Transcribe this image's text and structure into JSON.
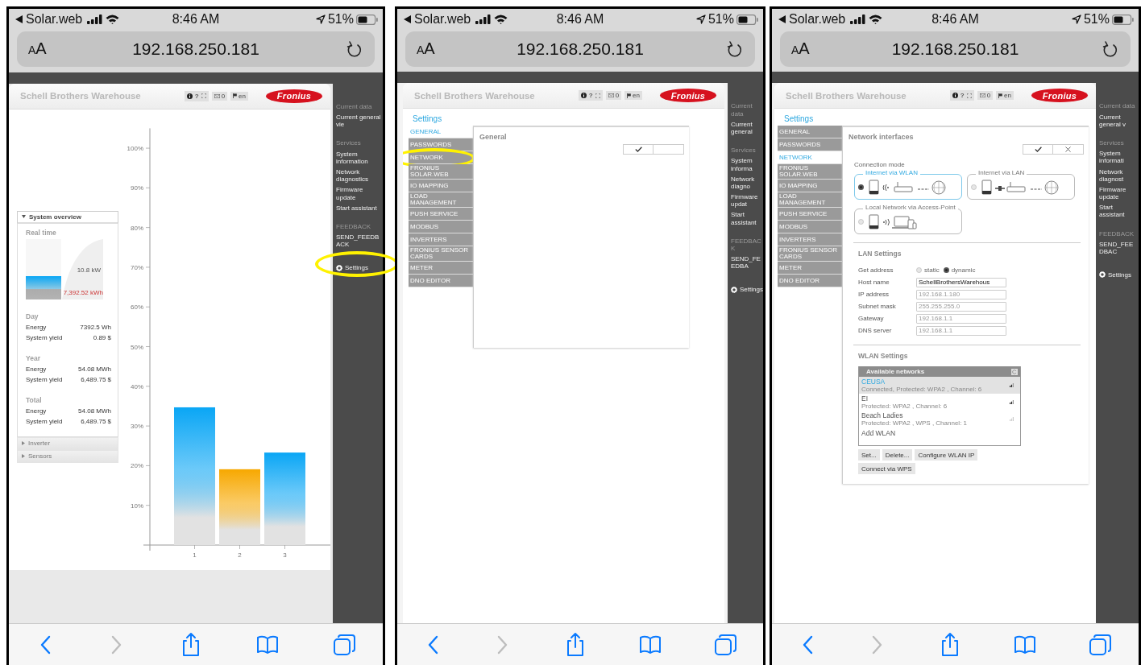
{
  "phones": [
    {
      "status_bar": {
        "back_label": "Solar.web",
        "time": "8:46 AM",
        "battery": "51%"
      },
      "address_bar": {
        "text_size": "AA",
        "url": "192.168.250.181"
      },
      "site": {
        "title": "Schell Brothers Warehouse",
        "help": "?",
        "mail_count": "0",
        "language": "en",
        "logo": "Fronius"
      },
      "sidebar": {
        "sections": [
          {
            "heading": "Current data",
            "items": [
              "Current general vie"
            ]
          },
          {
            "heading": "Services",
            "items": [
              "System information",
              "Network diagnostics",
              "Firmware update",
              "Start assistant"
            ]
          },
          {
            "heading": "FEEDBACK",
            "items": [
              "SEND_FEEDBACK"
            ]
          }
        ],
        "settings": {
          "label": "Settings",
          "highlighted": true
        }
      },
      "view": {
        "kind": "dashboard",
        "panels": [
          {
            "title": "System overview",
            "expanded": true
          },
          {
            "title": "Inverter",
            "expanded": false
          },
          {
            "title": "Sensors",
            "expanded": false
          }
        ],
        "realtime": {
          "title": "Real time",
          "power": "10.8 kW",
          "energy": "7,392.52 kWh",
          "level": 0.39
        },
        "periods": [
          {
            "title": "Day",
            "rows": [
              {
                "label": "Energy",
                "value": "7392.5 Wh"
              },
              {
                "label": "System yield",
                "value": "0.89 $"
              }
            ]
          },
          {
            "title": "Year",
            "rows": [
              {
                "label": "Energy",
                "value": "54.08 MWh"
              },
              {
                "label": "System yield",
                "value": "6,489.75 $"
              }
            ]
          },
          {
            "title": "Total",
            "rows": [
              {
                "label": "Energy",
                "value": "54.08 MWh"
              },
              {
                "label": "System yield",
                "value": "6,489.75 $"
              }
            ]
          }
        ],
        "chart_data": {
          "type": "bar",
          "categories": [
            "1",
            "2",
            "3"
          ],
          "stacked": true,
          "ylim": [
            0,
            105
          ],
          "series": [
            {
              "color": "#0aa6f5",
              "values": [
                34.7,
                null,
                23.3
              ]
            },
            {
              "color": "#f7a800",
              "values": [
                null,
                19.1,
                null
              ]
            }
          ],
          "yticks": [
            {
              "value": 10,
              "label": "10%"
            },
            {
              "value": 20,
              "label": "20%"
            },
            {
              "value": 30,
              "label": "30%"
            },
            {
              "value": 40,
              "label": "40%"
            },
            {
              "value": 50,
              "label": "50%"
            },
            {
              "value": 60,
              "label": "60%"
            },
            {
              "value": 70,
              "label": "70%"
            },
            {
              "value": 80,
              "label": "80%"
            },
            {
              "value": 90,
              "label": "90%"
            },
            {
              "value": 100,
              "label": "100%"
            }
          ]
        }
      },
      "toolbar": [
        {
          "kind": "back",
          "disabled": false
        },
        {
          "kind": "forward",
          "disabled": true
        },
        {
          "kind": "share",
          "disabled": false
        },
        {
          "kind": "bookmarks",
          "disabled": false
        },
        {
          "kind": "tabs",
          "disabled": false
        }
      ]
    },
    {
      "status_bar": {
        "back_label": "Solar.web",
        "time": "8:46 AM",
        "battery": "51%"
      },
      "address_bar": {
        "text_size": "AA",
        "url": "192.168.250.181"
      },
      "site": {
        "title": "Schell Brothers Warehouse",
        "help": "?",
        "mail_count": "0",
        "language": "en",
        "logo": "Fronius"
      },
      "sidebar": {
        "sections": [
          {
            "heading": "Current data",
            "items": [
              "Current general"
            ]
          },
          {
            "heading": "Services",
            "items": [
              "System informa",
              "Network diagno",
              "Firmware updat",
              "Start assistant"
            ]
          },
          {
            "heading": "FEEDBACK",
            "items": [
              "SEND_FEEDBA"
            ]
          }
        ],
        "settings": {
          "label": "Settings",
          "highlighted": false
        }
      },
      "view": {
        "kind": "settings",
        "title": "Settings",
        "tabs": [
          {
            "label": "GENERAL",
            "selected": true,
            "highlighted": false
          },
          {
            "label": "PASSWORDS",
            "selected": false,
            "highlighted": false
          },
          {
            "label": "NETWORK",
            "selected": false,
            "highlighted": true
          },
          {
            "label": "FRONIUS SOLAR.WEB",
            "selected": false,
            "highlighted": false
          },
          {
            "label": "IO MAPPING",
            "selected": false,
            "highlighted": false
          },
          {
            "label": "LOAD MANAGEMENT",
            "selected": false,
            "highlighted": false
          },
          {
            "label": "PUSH SERVICE",
            "selected": false,
            "highlighted": false
          },
          {
            "label": "MODBUS",
            "selected": false,
            "highlighted": false
          },
          {
            "label": "INVERTERS",
            "selected": false,
            "highlighted": false
          },
          {
            "label": "FRONIUS SENSOR CARDS",
            "selected": false,
            "highlighted": false
          },
          {
            "label": "METER",
            "selected": false,
            "highlighted": false
          },
          {
            "label": "DNO EDITOR",
            "selected": false,
            "highlighted": false
          }
        ],
        "panel": {
          "kind": "general",
          "title": "General",
          "buttons": [
            {
              "kind": "confirm"
            },
            {
              "kind": "blank"
            }
          ]
        }
      },
      "toolbar": [
        {
          "kind": "back",
          "disabled": false
        },
        {
          "kind": "forward",
          "disabled": true
        },
        {
          "kind": "share",
          "disabled": false
        },
        {
          "kind": "bookmarks",
          "disabled": false
        },
        {
          "kind": "tabs",
          "disabled": false
        }
      ]
    },
    {
      "status_bar": {
        "back_label": "Solar.web",
        "time": "8:46 AM",
        "battery": "51%"
      },
      "address_bar": {
        "text_size": "AA",
        "url": "192.168.250.181"
      },
      "site": {
        "title": "Schell Brothers Warehouse",
        "help": "?",
        "mail_count": "0",
        "language": "en",
        "logo": "Fronius"
      },
      "sidebar": {
        "sections": [
          {
            "heading": "Current data",
            "items": [
              "Current general v"
            ]
          },
          {
            "heading": "Services",
            "items": [
              "System informati",
              "Network diagnost",
              "Firmware update",
              "Start assistant"
            ]
          },
          {
            "heading": "FEEDBACK",
            "items": [
              "SEND_FEEDBAC"
            ]
          }
        ],
        "settings": {
          "label": "Settings",
          "highlighted": false
        }
      },
      "view": {
        "kind": "settings",
        "title": "Settings",
        "tabs": [
          {
            "label": "GENERAL",
            "selected": false,
            "highlighted": false
          },
          {
            "label": "PASSWORDS",
            "selected": false,
            "highlighted": false
          },
          {
            "label": "NETWORK",
            "selected": true,
            "highlighted": false
          },
          {
            "label": "FRONIUS SOLAR.WEB",
            "selected": false,
            "highlighted": false
          },
          {
            "label": "IO MAPPING",
            "selected": false,
            "highlighted": false
          },
          {
            "label": "LOAD MANAGEMENT",
            "selected": false,
            "highlighted": false
          },
          {
            "label": "PUSH SERVICE",
            "selected": false,
            "highlighted": false
          },
          {
            "label": "MODBUS",
            "selected": false,
            "highlighted": false
          },
          {
            "label": "INVERTERS",
            "selected": false,
            "highlighted": false
          },
          {
            "label": "FRONIUS SENSOR CARDS",
            "selected": false,
            "highlighted": false
          },
          {
            "label": "METER",
            "selected": false,
            "highlighted": false
          },
          {
            "label": "DNO EDITOR",
            "selected": false,
            "highlighted": false
          }
        ],
        "panel": {
          "kind": "network",
          "title": "Network interfaces",
          "buttons": [
            {
              "kind": "confirm"
            },
            {
              "kind": "cancel"
            }
          ],
          "connection": {
            "title": "Connection mode",
            "options": [
              {
                "label": "Internet via WLAN",
                "kind": "wlan",
                "selected": true
              },
              {
                "label": "Internet via LAN",
                "kind": "lan",
                "selected": false
              },
              {
                "label": "Local Network via Access-Point",
                "kind": "access_point",
                "selected": false
              }
            ]
          },
          "lan": {
            "title": "LAN Settings",
            "address_label": "Get address",
            "address_modes": [
              {
                "label": "static",
                "selected": false
              },
              {
                "label": "dynamic",
                "selected": true
              }
            ],
            "fields": [
              {
                "label": "Host name",
                "value": "SchellBrothersWarehous",
                "disabled": false
              },
              {
                "label": "IP address",
                "value": "192.168.1.180",
                "disabled": true
              },
              {
                "label": "Subnet mask",
                "value": "255.255.255.0",
                "disabled": true
              },
              {
                "label": "Gateway",
                "value": "192.168.1.1",
                "disabled": true
              },
              {
                "label": "DNS server",
                "value": "192.168.1.1",
                "disabled": true
              }
            ]
          },
          "wlan": {
            "title": "WLAN Settings",
            "list_title": "Available networks",
            "networks": [
              {
                "name": "CEUSA",
                "details": "Connected, Protected: WPA2 , Channel: 6",
                "selected": true,
                "weak": false
              },
              {
                "name": "EI",
                "details": "Protected: WPA2 , Channel: 6",
                "selected": false,
                "weak": false
              },
              {
                "name": "Beach Ladies",
                "details": "Protected: WPA2 , WPS , Channel: 1",
                "selected": false,
                "weak": true
              }
            ],
            "add_label": "Add WLAN",
            "buttons": [
              "Set...",
              "Delete...",
              "Configure WLAN IP",
              "Connect via WPS"
            ]
          }
        }
      },
      "toolbar": [
        {
          "kind": "back",
          "disabled": false
        },
        {
          "kind": "forward",
          "disabled": true
        },
        {
          "kind": "share",
          "disabled": false
        },
        {
          "kind": "bookmarks",
          "disabled": false
        },
        {
          "kind": "tabs",
          "disabled": false
        }
      ]
    }
  ]
}
